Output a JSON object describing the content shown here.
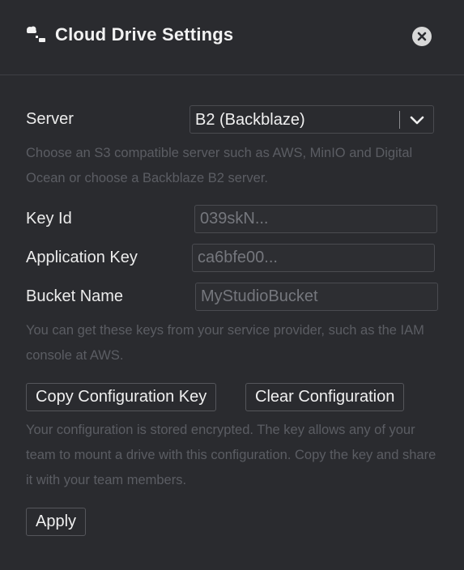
{
  "dialog": {
    "title": "Cloud Drive Settings",
    "title_icon": "cloud-drive-icon",
    "close_icon": "close-icon"
  },
  "server": {
    "label": "Server",
    "selected": "B2 (Backblaze)",
    "help": "Choose an S3 compatible server such as AWS, MinIO and Digital Ocean or choose a Backblaze B2 server."
  },
  "fields": {
    "key_id": {
      "label": "Key Id",
      "placeholder": "039skN..."
    },
    "application_key": {
      "label": "Application Key",
      "placeholder": "ca6bfe00..."
    },
    "bucket_name": {
      "label": "Bucket Name",
      "placeholder": "MyStudioBucket"
    },
    "help": "You can get these keys from your service provider, such as the IAM console at AWS."
  },
  "configuration": {
    "copy_label": "Copy Configuration Key",
    "clear_label": "Clear Configuration",
    "help": "Your configuration is stored encrypted. The key allows any of your team to mount a drive with this configuration. Copy the key and share it with your team members."
  },
  "apply_label": "Apply",
  "colors": {
    "background": "#2a2b2f",
    "text": "#ececec",
    "help_text": "#5b5d63",
    "border": "#4a4b50"
  }
}
